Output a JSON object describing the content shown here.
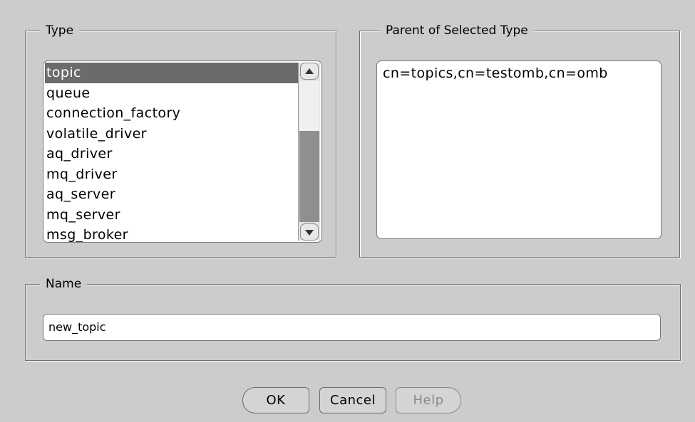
{
  "type_group": {
    "title": "Type",
    "items": [
      {
        "label": "topic",
        "selected": true
      },
      {
        "label": "queue",
        "selected": false
      },
      {
        "label": "connection_factory",
        "selected": false
      },
      {
        "label": "volatile_driver",
        "selected": false
      },
      {
        "label": "aq_driver",
        "selected": false
      },
      {
        "label": "mq_driver",
        "selected": false
      },
      {
        "label": "aq_server",
        "selected": false
      },
      {
        "label": "mq_server",
        "selected": false
      },
      {
        "label": "msg_broker",
        "selected": false
      }
    ]
  },
  "parent_group": {
    "title": "Parent of Selected Type",
    "value": "cn=topics,cn=testomb,cn=omb"
  },
  "name_group": {
    "title": "Name",
    "value": "new_topic"
  },
  "buttons": {
    "ok": "OK",
    "cancel": "Cancel",
    "help": "Help"
  },
  "colors": {
    "background": "#cccccc",
    "selection": "#6b6b6b",
    "disabled_text": "#8a8a8a"
  },
  "icons": {
    "scroll_up": "triangle-up-icon",
    "scroll_down": "triangle-down-icon"
  }
}
